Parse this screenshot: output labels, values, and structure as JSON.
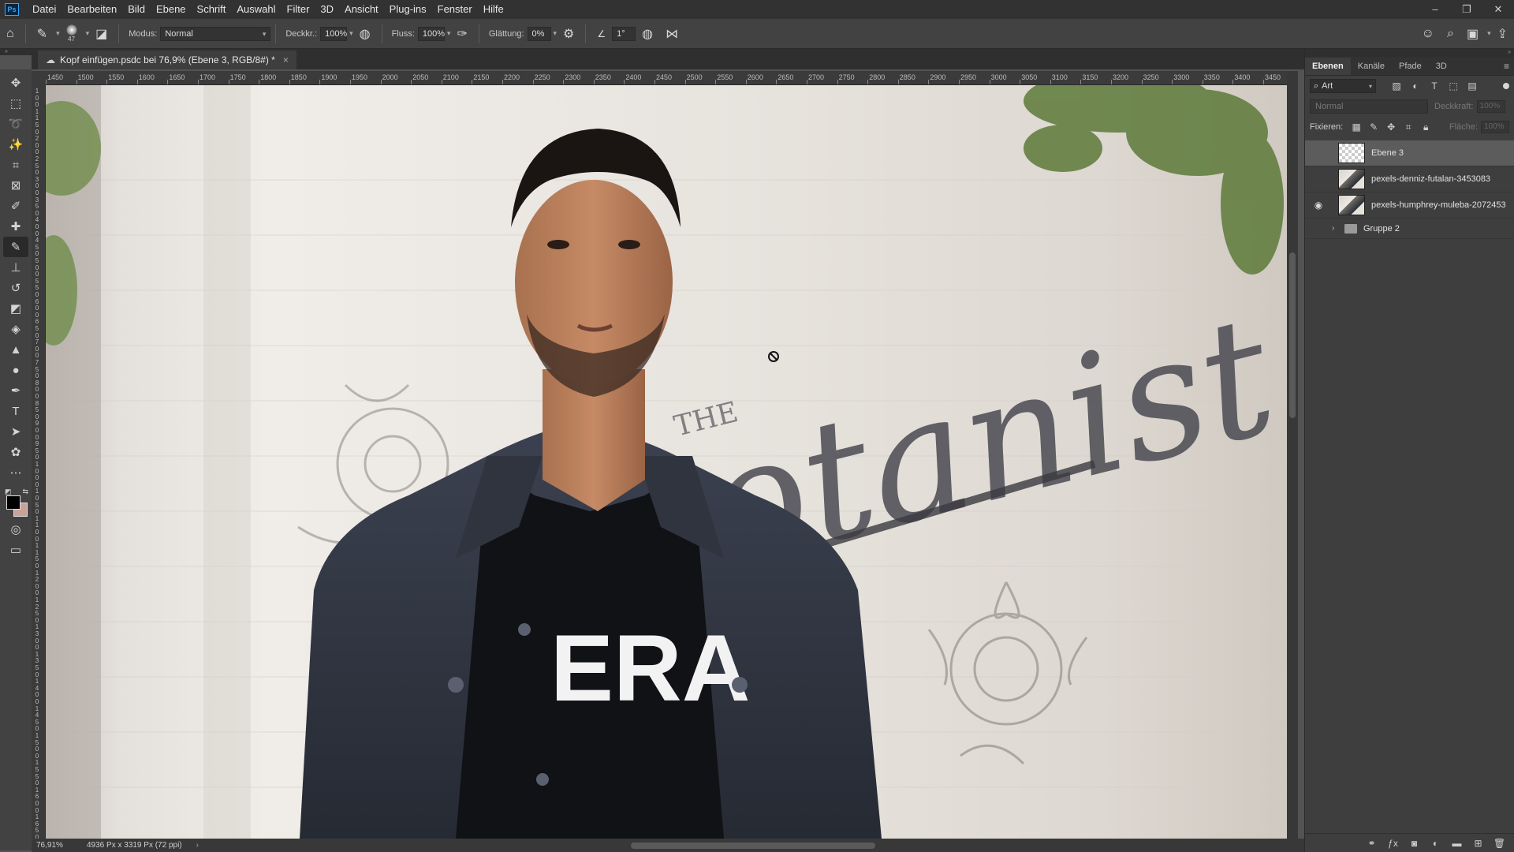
{
  "menubar": {
    "logo": "Ps",
    "items": [
      "Datei",
      "Bearbeiten",
      "Bild",
      "Ebene",
      "Schrift",
      "Auswahl",
      "Filter",
      "3D",
      "Ansicht",
      "Plug-ins",
      "Fenster",
      "Hilfe"
    ],
    "window_controls": [
      "–",
      "❐",
      "✕"
    ]
  },
  "options": {
    "brush_size": "47",
    "mode_label": "Modus:",
    "mode_value": "Normal",
    "opacity_label": "Deckkr.:",
    "opacity_value": "100%",
    "flow_label": "Fluss:",
    "flow_value": "100%",
    "smoothing_label": "Glättung:",
    "smoothing_value": "0%",
    "angle_value": "1°"
  },
  "document": {
    "tab_title": "Kopf einfügen.psdc bei 76,9% (Ebene 3, RGB/8#) *",
    "close": "×"
  },
  "ruler": {
    "h_labels": [
      "1450",
      "1500",
      "1550",
      "1600",
      "1650",
      "1700",
      "1750",
      "1800",
      "1850",
      "1900",
      "1950",
      "2000",
      "2050",
      "2100",
      "2150",
      "2200",
      "2250",
      "2300",
      "2350",
      "2400",
      "2450",
      "2500",
      "2550",
      "2600",
      "2650",
      "2700",
      "2750",
      "2800",
      "2850",
      "2900",
      "2950",
      "3000",
      "3050",
      "3100",
      "3150",
      "3200",
      "3250",
      "3300",
      "3350",
      "3400",
      "3450"
    ],
    "v_labels": [
      "1",
      "0",
      "0",
      "1",
      "1",
      "5",
      "0",
      "2",
      "0",
      "0",
      "2",
      "5",
      "0",
      "3",
      "0",
      "0",
      "3",
      "5",
      "0",
      "4",
      "0",
      "0",
      "4",
      "5",
      "0",
      "5",
      "0",
      "0",
      "5",
      "5",
      "0",
      "6",
      "0",
      "0",
      "6",
      "5",
      "0",
      "7",
      "0",
      "0",
      "7",
      "5",
      "0",
      "8",
      "0",
      "0",
      "8",
      "5",
      "0",
      "9",
      "0",
      "0",
      "9",
      "5",
      "0",
      "1",
      "0",
      "0",
      "0",
      "1",
      "0",
      "5",
      "0",
      "1",
      "1",
      "0",
      "0",
      "1",
      "1",
      "5",
      "0",
      "1",
      "2",
      "0",
      "0",
      "1",
      "2",
      "5",
      "0",
      "1",
      "3",
      "0",
      "0",
      "1",
      "3",
      "5",
      "0",
      "1",
      "4",
      "0",
      "0",
      "1",
      "4",
      "5",
      "0",
      "1",
      "5",
      "0",
      "0",
      "1",
      "5",
      "5",
      "0",
      "1",
      "6",
      "0",
      "0",
      "1",
      "6",
      "5",
      "0",
      "1",
      "7",
      "0",
      "0"
    ]
  },
  "canvas": {
    "shirt_text": "ERA",
    "wall_text": "otanist",
    "wall_text_small": "THE"
  },
  "status": {
    "zoom": "76,91%",
    "info": "4936 Px x 3319 Px (72 ppi)",
    "arrow": "›"
  },
  "panel": {
    "tabs": [
      "Ebenen",
      "Kanäle",
      "Pfade",
      "3D"
    ],
    "filter_kind": "Art",
    "blend_mode": "Normal",
    "opacity_label": "Deckkraft:",
    "opacity_value": "100%",
    "lock_label": "Fixieren:",
    "fill_label": "Fläche:",
    "fill_value": "100%",
    "layers": [
      {
        "name": "Ebene 3",
        "visible": false,
        "selected": true
      },
      {
        "name": "pexels-denniz-futalan-3453083",
        "visible": false,
        "selected": false
      },
      {
        "name": "pexels-humphrey-muleba-2072453",
        "visible": true,
        "selected": false
      }
    ],
    "group_name": "Gruppe 2"
  },
  "colors": {
    "foreground": "#000000",
    "background": "#c9a397",
    "accent": "#31a8ff"
  }
}
